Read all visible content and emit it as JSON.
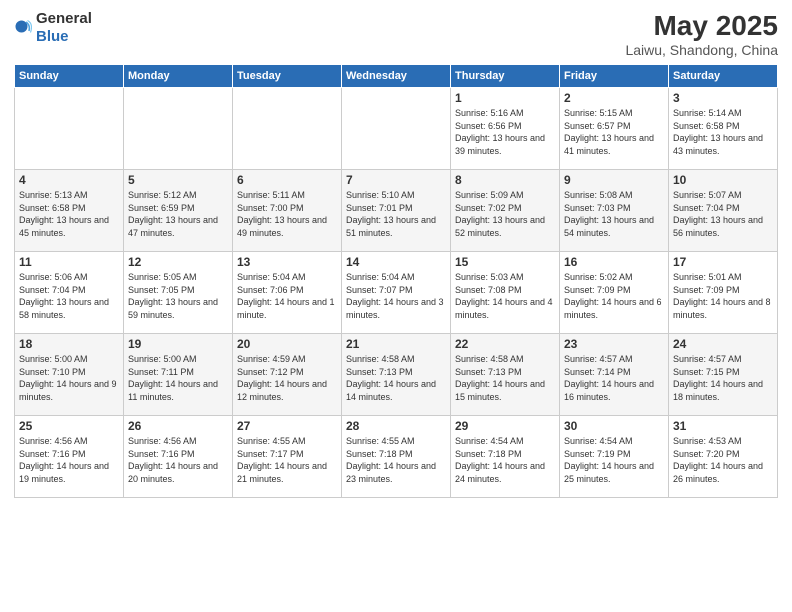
{
  "header": {
    "logo_general": "General",
    "logo_blue": "Blue",
    "title": "May 2025",
    "subtitle": "Laiwu, Shandong, China"
  },
  "days_of_week": [
    "Sunday",
    "Monday",
    "Tuesday",
    "Wednesday",
    "Thursday",
    "Friday",
    "Saturday"
  ],
  "weeks": [
    {
      "days": [
        {
          "num": "",
          "empty": true
        },
        {
          "num": "",
          "empty": true
        },
        {
          "num": "",
          "empty": true
        },
        {
          "num": "",
          "empty": true
        },
        {
          "num": "1",
          "sunrise": "5:16 AM",
          "sunset": "6:56 PM",
          "daylight": "13 hours and 39 minutes."
        },
        {
          "num": "2",
          "sunrise": "5:15 AM",
          "sunset": "6:57 PM",
          "daylight": "13 hours and 41 minutes."
        },
        {
          "num": "3",
          "sunrise": "5:14 AM",
          "sunset": "6:58 PM",
          "daylight": "13 hours and 43 minutes."
        }
      ]
    },
    {
      "days": [
        {
          "num": "4",
          "sunrise": "5:13 AM",
          "sunset": "6:58 PM",
          "daylight": "13 hours and 45 minutes."
        },
        {
          "num": "5",
          "sunrise": "5:12 AM",
          "sunset": "6:59 PM",
          "daylight": "13 hours and 47 minutes."
        },
        {
          "num": "6",
          "sunrise": "5:11 AM",
          "sunset": "7:00 PM",
          "daylight": "13 hours and 49 minutes."
        },
        {
          "num": "7",
          "sunrise": "5:10 AM",
          "sunset": "7:01 PM",
          "daylight": "13 hours and 51 minutes."
        },
        {
          "num": "8",
          "sunrise": "5:09 AM",
          "sunset": "7:02 PM",
          "daylight": "13 hours and 52 minutes."
        },
        {
          "num": "9",
          "sunrise": "5:08 AM",
          "sunset": "7:03 PM",
          "daylight": "13 hours and 54 minutes."
        },
        {
          "num": "10",
          "sunrise": "5:07 AM",
          "sunset": "7:04 PM",
          "daylight": "13 hours and 56 minutes."
        }
      ]
    },
    {
      "days": [
        {
          "num": "11",
          "sunrise": "5:06 AM",
          "sunset": "7:04 PM",
          "daylight": "13 hours and 58 minutes."
        },
        {
          "num": "12",
          "sunrise": "5:05 AM",
          "sunset": "7:05 PM",
          "daylight": "13 hours and 59 minutes."
        },
        {
          "num": "13",
          "sunrise": "5:04 AM",
          "sunset": "7:06 PM",
          "daylight": "14 hours and 1 minute."
        },
        {
          "num": "14",
          "sunrise": "5:04 AM",
          "sunset": "7:07 PM",
          "daylight": "14 hours and 3 minutes."
        },
        {
          "num": "15",
          "sunrise": "5:03 AM",
          "sunset": "7:08 PM",
          "daylight": "14 hours and 4 minutes."
        },
        {
          "num": "16",
          "sunrise": "5:02 AM",
          "sunset": "7:09 PM",
          "daylight": "14 hours and 6 minutes."
        },
        {
          "num": "17",
          "sunrise": "5:01 AM",
          "sunset": "7:09 PM",
          "daylight": "14 hours and 8 minutes."
        }
      ]
    },
    {
      "days": [
        {
          "num": "18",
          "sunrise": "5:00 AM",
          "sunset": "7:10 PM",
          "daylight": "14 hours and 9 minutes."
        },
        {
          "num": "19",
          "sunrise": "5:00 AM",
          "sunset": "7:11 PM",
          "daylight": "14 hours and 11 minutes."
        },
        {
          "num": "20",
          "sunrise": "4:59 AM",
          "sunset": "7:12 PM",
          "daylight": "14 hours and 12 minutes."
        },
        {
          "num": "21",
          "sunrise": "4:58 AM",
          "sunset": "7:13 PM",
          "daylight": "14 hours and 14 minutes."
        },
        {
          "num": "22",
          "sunrise": "4:58 AM",
          "sunset": "7:13 PM",
          "daylight": "14 hours and 15 minutes."
        },
        {
          "num": "23",
          "sunrise": "4:57 AM",
          "sunset": "7:14 PM",
          "daylight": "14 hours and 16 minutes."
        },
        {
          "num": "24",
          "sunrise": "4:57 AM",
          "sunset": "7:15 PM",
          "daylight": "14 hours and 18 minutes."
        }
      ]
    },
    {
      "days": [
        {
          "num": "25",
          "sunrise": "4:56 AM",
          "sunset": "7:16 PM",
          "daylight": "14 hours and 19 minutes."
        },
        {
          "num": "26",
          "sunrise": "4:56 AM",
          "sunset": "7:16 PM",
          "daylight": "14 hours and 20 minutes."
        },
        {
          "num": "27",
          "sunrise": "4:55 AM",
          "sunset": "7:17 PM",
          "daylight": "14 hours and 21 minutes."
        },
        {
          "num": "28",
          "sunrise": "4:55 AM",
          "sunset": "7:18 PM",
          "daylight": "14 hours and 23 minutes."
        },
        {
          "num": "29",
          "sunrise": "4:54 AM",
          "sunset": "7:18 PM",
          "daylight": "14 hours and 24 minutes."
        },
        {
          "num": "30",
          "sunrise": "4:54 AM",
          "sunset": "7:19 PM",
          "daylight": "14 hours and 25 minutes."
        },
        {
          "num": "31",
          "sunrise": "4:53 AM",
          "sunset": "7:20 PM",
          "daylight": "14 hours and 26 minutes."
        }
      ]
    }
  ]
}
